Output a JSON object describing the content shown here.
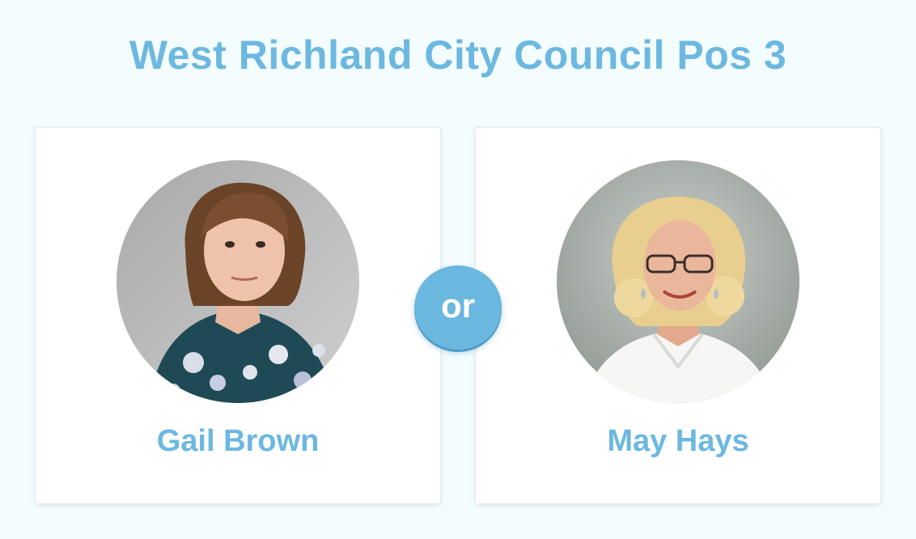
{
  "page": {
    "title": "West Richland City Council Pos 3",
    "accent_color": "#6cb8e0",
    "background_color": "#f4fdfe"
  },
  "matchup": {
    "separator_label": "or",
    "candidates": [
      {
        "name": "Gail Brown",
        "photo": "candidate-portrait"
      },
      {
        "name": "May Hays",
        "photo": "candidate-portrait"
      }
    ]
  }
}
